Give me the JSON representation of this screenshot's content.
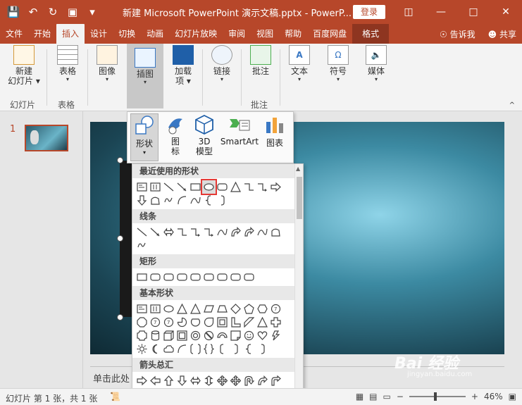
{
  "window": {
    "title": "新建 Microsoft PowerPoint 演示文稿.pptx  -  PowerP...",
    "login_label": "登录"
  },
  "tabs": [
    "文件",
    "开始",
    "插入",
    "设计",
    "切换",
    "动画",
    "幻灯片放映",
    "审阅",
    "视图",
    "帮助",
    "百度网盘",
    "格式"
  ],
  "tabs_active": "插入",
  "tab_right": {
    "tell_me": "告诉我",
    "share": "共享"
  },
  "ribbon": {
    "new_slide": "新建\n幻灯片",
    "slides_group": "幻灯片",
    "table": "表格",
    "table_group": "表格",
    "image": "图像",
    "illustrations": "插图",
    "addins": "加载\n项",
    "links": "链接",
    "comment": "批注",
    "comment_group": "批注",
    "text": "文本",
    "symbol": "符号",
    "media": "媒体"
  },
  "illustrations_menu": {
    "shapes": "形状",
    "icons": "图\n标",
    "model3d": "3D\n模型",
    "smartart": "SmartArt",
    "chart": "图表"
  },
  "shapes_panel": {
    "sections": [
      "最近使用的形状",
      "线条",
      "矩形",
      "基本形状",
      "箭头总汇"
    ]
  },
  "slide_panel": {
    "slide_number": "1"
  },
  "notes_placeholder": "单击此处",
  "status": {
    "slide_info": "幻灯片 第 1 张，共 1 张",
    "zoom": "46%",
    "zoom_fraction": 0.46
  },
  "watermark": {
    "text": "Bai 经验",
    "sub": "jingyan.baidu.com"
  },
  "colors": {
    "accent": "#b7472a",
    "selected_outline": "#e53935"
  }
}
